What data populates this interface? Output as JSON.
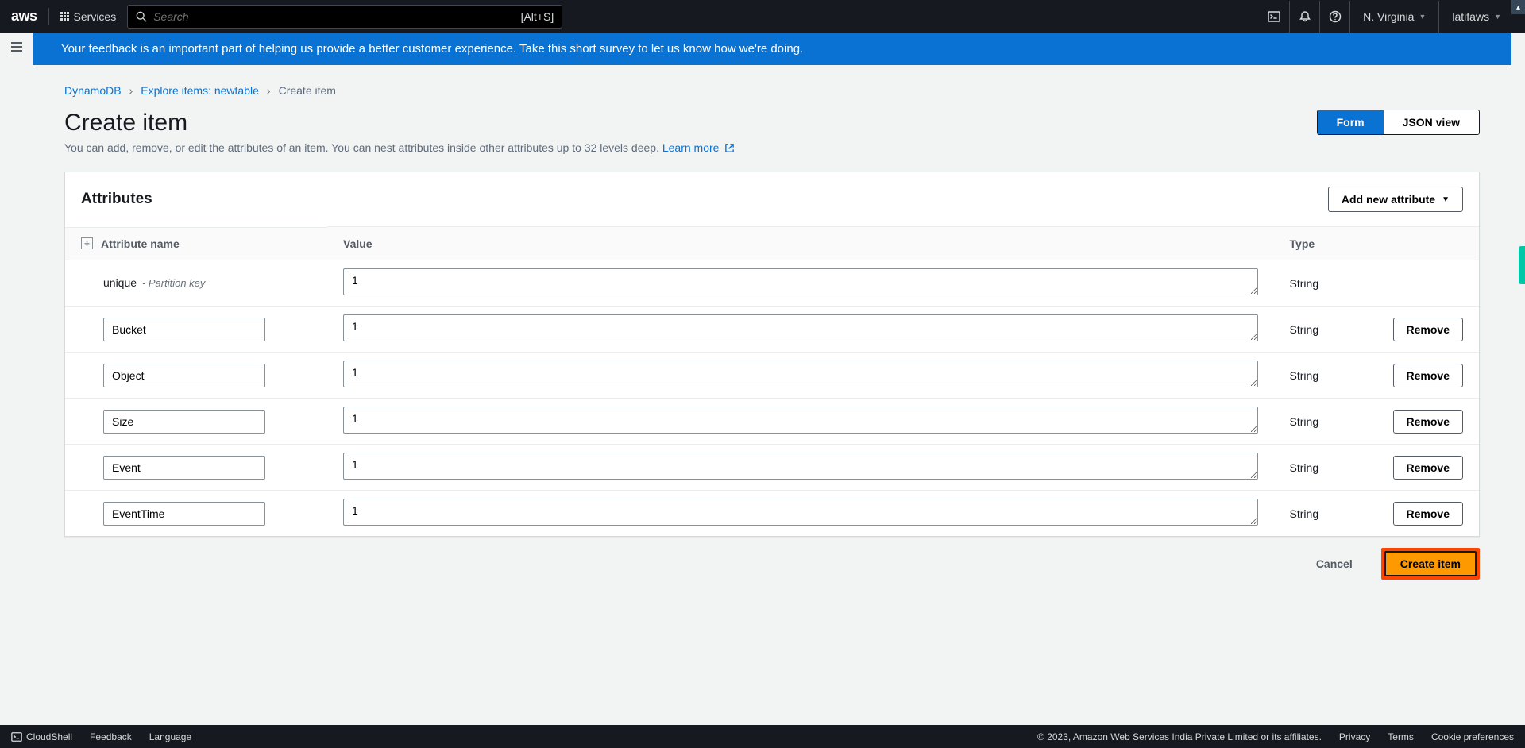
{
  "topbar": {
    "services_label": "Services",
    "search_placeholder": "Search",
    "search_hint": "[Alt+S]",
    "region": "N. Virginia",
    "account": "latifaws"
  },
  "banner": {
    "text": "Your feedback is an important part of helping us provide a better customer experience. Take this short survey to let us know how we're doing."
  },
  "breadcrumbs": {
    "a": "DynamoDB",
    "b": "Explore items: newtable",
    "c": "Create item"
  },
  "page": {
    "title": "Create item",
    "subtitle_pre": "You can add, remove, or edit the attributes of an item. You can nest attributes inside other attributes up to 32 levels deep. ",
    "learn_more": "Learn more",
    "form_btn": "Form",
    "json_btn": "JSON view"
  },
  "card": {
    "title": "Attributes",
    "add_btn": "Add new attribute",
    "col_name": "Attribute name",
    "col_val": "Value",
    "col_type": "Type",
    "remove_label": "Remove"
  },
  "rows": [
    {
      "name": "unique",
      "pk": "- Partition key",
      "value": "1",
      "type": "String",
      "removable": false
    },
    {
      "name": "Bucket",
      "value": "1",
      "type": "String",
      "removable": true
    },
    {
      "name": "Object",
      "value": "1",
      "type": "String",
      "removable": true
    },
    {
      "name": "Size",
      "value": "1",
      "type": "String",
      "removable": true
    },
    {
      "name": "Event",
      "value": "1",
      "type": "String",
      "removable": true
    },
    {
      "name": "EventTime",
      "value": "1",
      "type": "String",
      "removable": true
    }
  ],
  "actions": {
    "cancel": "Cancel",
    "create": "Create item"
  },
  "footer": {
    "cloudshell": "CloudShell",
    "feedback": "Feedback",
    "language": "Language",
    "copyright": "© 2023, Amazon Web Services India Private Limited or its affiliates.",
    "privacy": "Privacy",
    "terms": "Terms",
    "cookie": "Cookie preferences"
  }
}
